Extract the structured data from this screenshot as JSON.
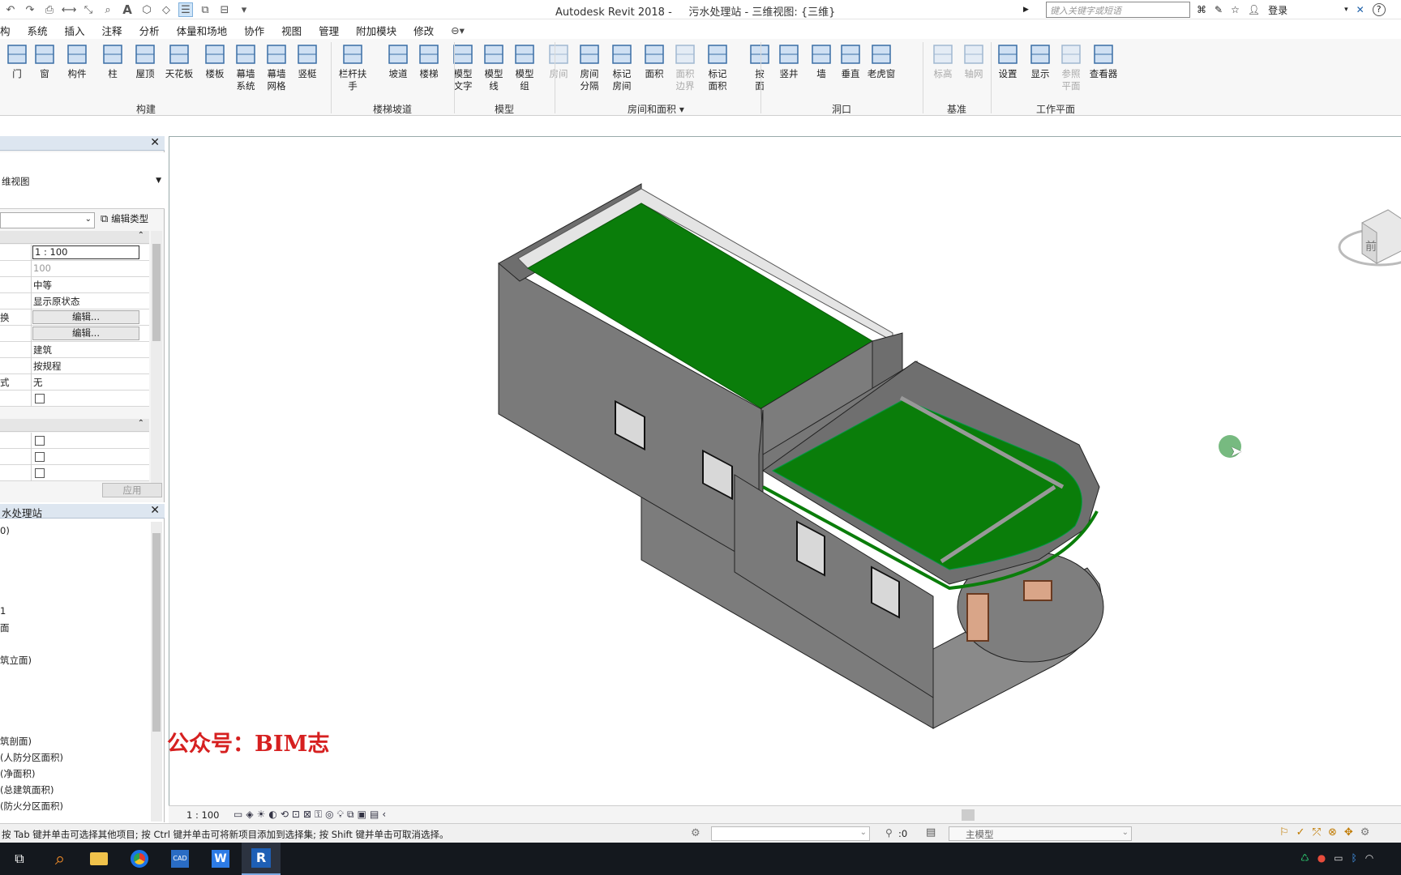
{
  "title_bar": {
    "app_title": "Autodesk Revit 2018 -     污水处理站 - 三维视图: {三维}",
    "search_placeholder": "键入关键字或短语",
    "login_label": "登录"
  },
  "menu_tabs": [
    "构",
    "系统",
    "插入",
    "注释",
    "分析",
    "体量和场地",
    "协作",
    "视图",
    "管理",
    "附加模块",
    "修改"
  ],
  "ribbon": {
    "buttons": [
      {
        "label": "门",
        "icon": "door-icon"
      },
      {
        "label": "窗",
        "icon": "window-icon"
      },
      {
        "label": "构件",
        "icon": "component-icon"
      },
      {
        "label": "柱",
        "icon": "column-icon"
      },
      {
        "label": "屋顶",
        "icon": "roof-icon"
      },
      {
        "label": "天花板",
        "icon": "ceiling-icon"
      },
      {
        "label": "楼板",
        "icon": "floor-icon"
      },
      {
        "label": "幕墙\n系统",
        "icon": "curtain-system-icon"
      },
      {
        "label": "幕墙\n网格",
        "icon": "curtain-grid-icon"
      },
      {
        "label": "竖梃",
        "icon": "mullion-icon"
      },
      {
        "label": "栏杆扶手",
        "icon": "railing-icon"
      },
      {
        "label": "坡道",
        "icon": "ramp-icon"
      },
      {
        "label": "楼梯",
        "icon": "stair-icon"
      },
      {
        "label": "模型\n文字",
        "icon": "model-text-icon"
      },
      {
        "label": "模型\n线",
        "icon": "model-line-icon"
      },
      {
        "label": "模型\n组",
        "icon": "model-group-icon"
      },
      {
        "label": "房间",
        "icon": "room-icon",
        "disabled": true
      },
      {
        "label": "房间\n分隔",
        "icon": "room-separator-icon"
      },
      {
        "label": "标记\n房间",
        "icon": "tag-room-icon"
      },
      {
        "label": "面积",
        "icon": "area-icon"
      },
      {
        "label": "面积\n边界",
        "icon": "area-boundary-icon",
        "disabled": true
      },
      {
        "label": "标记\n面积",
        "icon": "tag-area-icon"
      },
      {
        "label": "按\n面",
        "icon": "by-face-icon"
      },
      {
        "label": "竖井",
        "icon": "shaft-icon"
      },
      {
        "label": "墙",
        "icon": "wall-opening-icon"
      },
      {
        "label": "垂直",
        "icon": "vertical-icon"
      },
      {
        "label": "老虎窗",
        "icon": "dormer-icon"
      },
      {
        "label": "标高",
        "icon": "level-icon",
        "disabled": true
      },
      {
        "label": "轴网",
        "icon": "grid-icon",
        "disabled": true
      },
      {
        "label": "设置",
        "icon": "set-icon"
      },
      {
        "label": "显示",
        "icon": "show-icon"
      },
      {
        "label": "参照\n平面",
        "icon": "ref-plane-icon",
        "disabled": true
      },
      {
        "label": "查看器",
        "icon": "viewer-icon"
      }
    ],
    "panels": [
      "构建",
      "楼梯坡道",
      "模型",
      "房间和面积 ▾",
      "洞口",
      "基准",
      "工作平面"
    ]
  },
  "properties": {
    "view_type": "维视图",
    "edit_type_label": "编辑类型",
    "rows": [
      {
        "name": "",
        "value": "1 : 100",
        "kind": "input"
      },
      {
        "name": "",
        "value": "100",
        "kind": "grey"
      },
      {
        "name": "",
        "value": "中等",
        "kind": "text"
      },
      {
        "name": "",
        "value": "显示原状态",
        "kind": "text"
      },
      {
        "name": "换",
        "value": "编辑...",
        "kind": "button"
      },
      {
        "name": "",
        "value": "编辑...",
        "kind": "button"
      },
      {
        "name": "",
        "value": "建筑",
        "kind": "text"
      },
      {
        "name": "",
        "value": "按规程",
        "kind": "text"
      },
      {
        "name": "式",
        "value": "无",
        "kind": "text"
      },
      {
        "name": "",
        "value": "",
        "kind": "checkbox"
      }
    ],
    "apply_label": "应用"
  },
  "browser": {
    "title": "水处理站",
    "items": [
      "0)",
      "1",
      "面",
      "筑立面)",
      "筑剖面)",
      "(人防分区面积)",
      "(净面积)",
      "(总建筑面积)",
      "(防火分区面积)"
    ]
  },
  "viewport": {
    "watermark": "公众号：BIM志",
    "viewcube_face": "前"
  },
  "view_control": {
    "scale": "1 : 100"
  },
  "status": {
    "message": "按 Tab 键并单击可选择其他项目; 按 Ctrl 键并单击可将新项目添加到选择集; 按 Shift 键并单击可取消选择。",
    "selection_count": ":0",
    "model_label": "主模型"
  },
  "colors": {
    "roof_green": "#0a7d0a",
    "wall_grey": "#7c7c7c",
    "watermark_red": "#d62020"
  }
}
